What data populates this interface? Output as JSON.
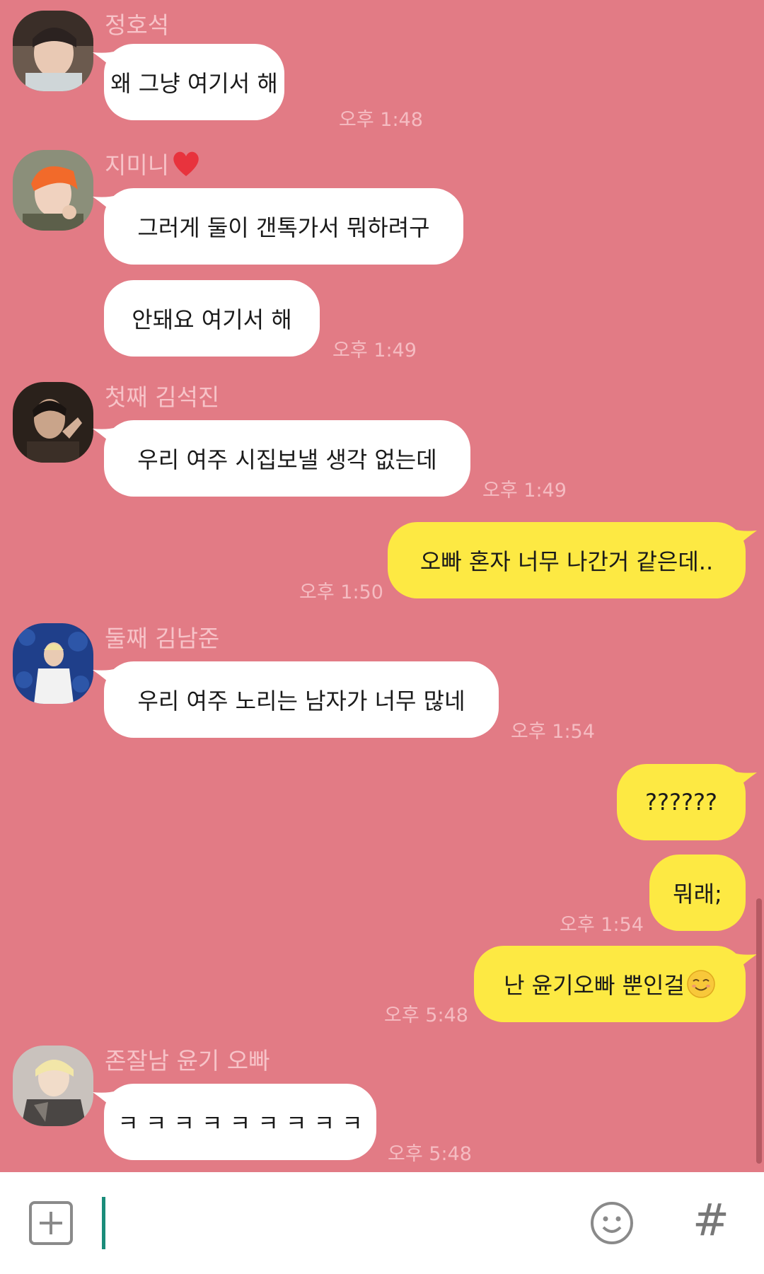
{
  "colors": {
    "background": "#e27b85",
    "incoming_bubble": "#ffffff",
    "outgoing_bubble": "#fde943",
    "name_text": "#f7c3c8",
    "time_text": "#f5bcc2",
    "cursor": "#1a8c7a"
  },
  "messages": [
    {
      "sender": "정호석",
      "text": "왜 그냥 여기서 해",
      "time": "오후 1:48"
    },
    {
      "sender": "지미니",
      "sender_icon": "heart-icon",
      "text": "그러게 둘이 갠톡가서 뭐하려구"
    },
    {
      "text": "안돼요 여기서 해",
      "time": "오후 1:49"
    },
    {
      "sender": "첫째 김석진",
      "text": "우리 여주 시집보낼 생각 없는데",
      "time": "오후 1:49"
    },
    {
      "outgoing": true,
      "text": "오빠 혼자 너무 나간거 같은데..",
      "time": "오후 1:50"
    },
    {
      "sender": "둘째 김남준",
      "text": "우리 여주 노리는 남자가 너무 많네",
      "time": "오후 1:54"
    },
    {
      "outgoing": true,
      "text": "??????"
    },
    {
      "outgoing": true,
      "text": "뭐래;",
      "time": "오후 1:54"
    },
    {
      "outgoing": true,
      "text": "난 윤기오빠 뿐인걸",
      "trailing_icon": "smiling-face-emoji-icon",
      "time": "오후 5:48"
    },
    {
      "sender": "존잘남 윤기 오빠",
      "text": "ㅋ ㅋ ㅋ ㅋ ㅋ ㅋ ㅋ ㅋ ㅋ",
      "time": "오후 5:48"
    }
  ],
  "input_bar": {
    "plus_icon": "plus-box-icon",
    "emoticon_icon": "smiley-face-icon",
    "hashtag_label": "#"
  }
}
